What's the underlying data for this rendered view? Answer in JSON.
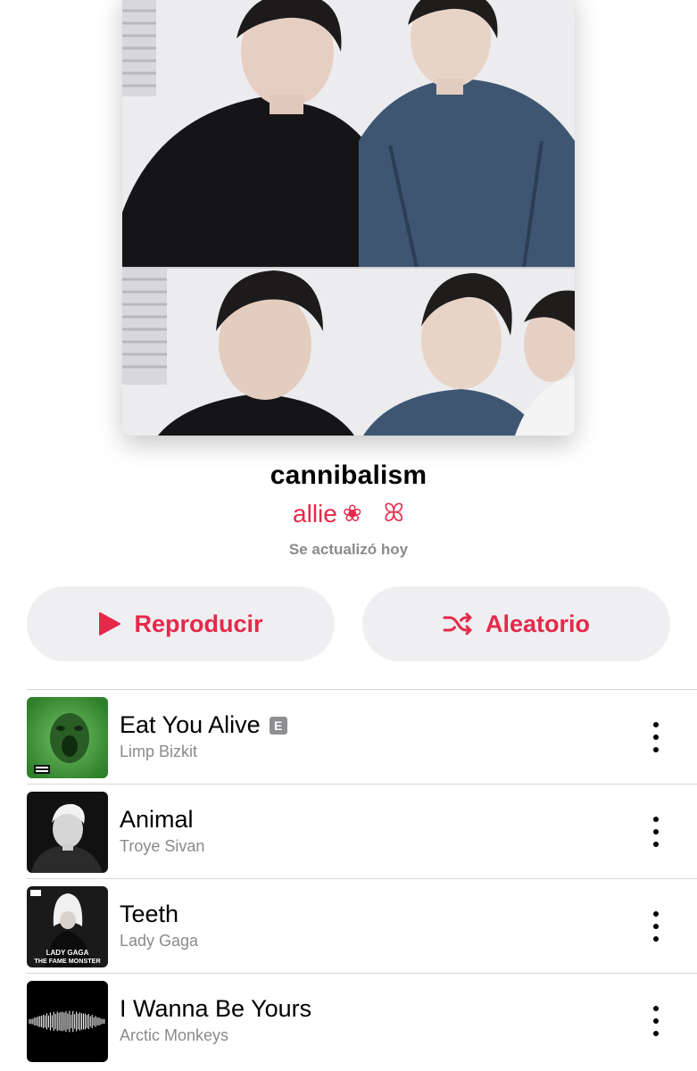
{
  "playlist": {
    "title": "cannibalism",
    "curator": "allie",
    "curator_flower": "❀",
    "curator_symbol": "ꕤ",
    "updated": "Se actualizó hoy"
  },
  "actions": {
    "play_label": "Reproducir",
    "shuffle_label": "Aleatorio"
  },
  "colors": {
    "accent": "#e5294a",
    "button_bg": "#efeff1",
    "secondary_text": "#8a8a8e"
  },
  "tracks": [
    {
      "title": "Eat You Alive",
      "artist": "Limp Bizkit",
      "explicit": "E",
      "art": "green-album-art"
    },
    {
      "title": "Animal",
      "artist": "Troye Sivan",
      "art": "bw-portrait-album-art"
    },
    {
      "title": "Teeth",
      "artist": "Lady Gaga",
      "art": "the-fame-monster-album-art",
      "art_text": "LADY GAGA THE FAME MONSTER"
    },
    {
      "title": "I Wanna Be Yours",
      "artist": "Arctic Monkeys",
      "art": "soundwave-album-art"
    }
  ],
  "icons": {
    "play": "play-icon",
    "shuffle": "shuffle-icon",
    "more": "more-vertical-icon"
  }
}
